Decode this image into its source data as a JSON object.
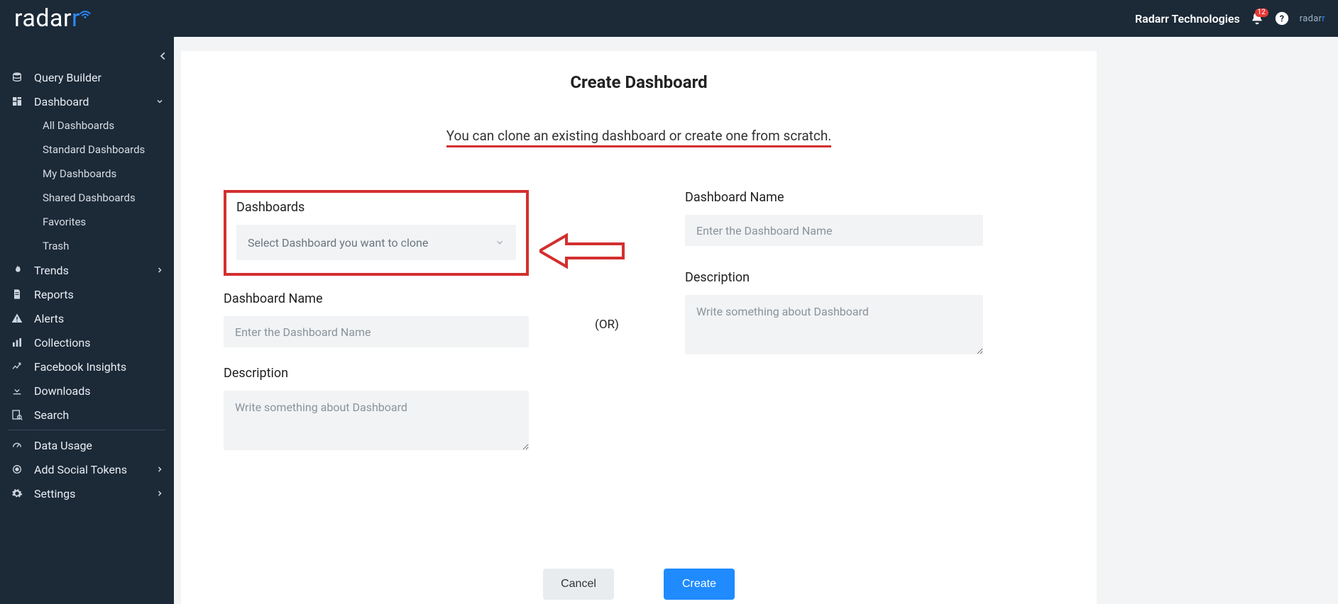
{
  "header": {
    "org": "Radarr Technologies",
    "notif_count": "12",
    "logo_text_a": "radar",
    "logo_text_b": "r"
  },
  "sidebar": {
    "items": [
      {
        "label": "Query Builder"
      },
      {
        "label": "Dashboard"
      },
      {
        "label": "Trends"
      },
      {
        "label": "Reports"
      },
      {
        "label": "Alerts"
      },
      {
        "label": "Collections"
      },
      {
        "label": "Facebook Insights"
      },
      {
        "label": "Downloads"
      },
      {
        "label": "Search"
      },
      {
        "label": "Data Usage"
      },
      {
        "label": "Add Social Tokens"
      },
      {
        "label": "Settings"
      }
    ],
    "dashboard_sub": [
      "All Dashboards",
      "Standard Dashboards",
      "My Dashboards",
      "Shared Dashboards",
      "Favorites",
      "Trash"
    ]
  },
  "page": {
    "title": "Create Dashboard",
    "subtitle": "You can clone an existing dashboard or create one from scratch.",
    "or": "(OR)"
  },
  "clone": {
    "section_label": "Dashboards",
    "select_placeholder": "Select Dashboard you want to clone",
    "name_label": "Dashboard Name",
    "name_placeholder": "Enter the Dashboard Name",
    "desc_label": "Description",
    "desc_placeholder": "Write something about Dashboard"
  },
  "scratch": {
    "name_label": "Dashboard Name",
    "name_placeholder": "Enter the Dashboard Name",
    "desc_label": "Description",
    "desc_placeholder": "Write something about Dashboard"
  },
  "actions": {
    "cancel": "Cancel",
    "create": "Create"
  }
}
